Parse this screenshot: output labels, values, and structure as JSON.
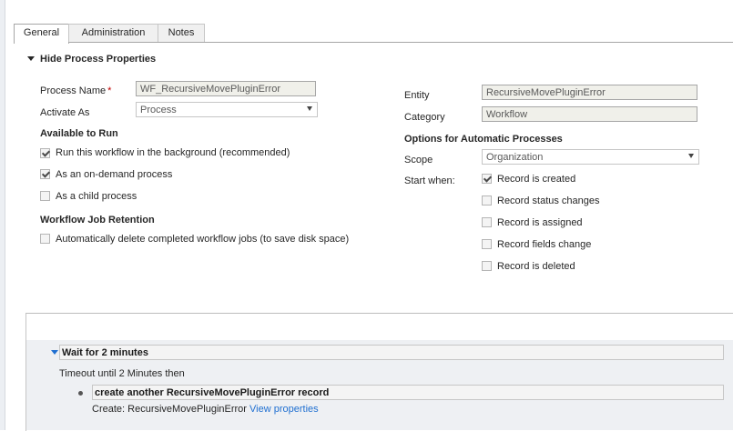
{
  "tabs": [
    {
      "label": "General",
      "active": true
    },
    {
      "label": "Administration",
      "active": false
    },
    {
      "label": "Notes",
      "active": false
    }
  ],
  "section": {
    "toggle_label": "Hide Process Properties"
  },
  "left": {
    "process_name_label": "Process Name",
    "required_mark": "*",
    "process_name_value": "WF_RecursiveMovePluginError",
    "activate_as_label": "Activate As",
    "activate_as_value": "Process",
    "available_heading": "Available to Run",
    "available_options": [
      {
        "label": "Run this workflow in the background (recommended)",
        "checked": true
      },
      {
        "label": "As an on-demand process",
        "checked": true
      },
      {
        "label": "As a child process",
        "checked": false
      }
    ],
    "retention_heading": "Workflow Job Retention",
    "retention_option": {
      "label": "Automatically delete completed workflow jobs (to save disk space)",
      "checked": false
    }
  },
  "right": {
    "entity_label": "Entity",
    "entity_value": "RecursiveMovePluginError",
    "category_label": "Category",
    "category_value": "Workflow",
    "options_heading": "Options for Automatic Processes",
    "scope_label": "Scope",
    "scope_value": "Organization",
    "start_when_label": "Start when:",
    "start_options": [
      {
        "label": "Record is created",
        "checked": true
      },
      {
        "label": "Record status changes",
        "checked": false
      },
      {
        "label": "Record is assigned",
        "checked": false
      },
      {
        "label": "Record fields change",
        "checked": false
      },
      {
        "label": "Record is deleted",
        "checked": false
      }
    ]
  },
  "designer": {
    "wait_step_title": "Wait for 2 minutes",
    "timeout_text": "Timeout until 2 Minutes then",
    "create_step_title": "create another RecursiveMovePluginError record",
    "create_detail_prefix": "Create:",
    "create_detail_entity": "RecursiveMovePluginError",
    "view_properties_link": "View properties"
  },
  "colors": {
    "link": "#1f6fd1",
    "required": "#c00000",
    "readonly_bg": "#f0f0ea"
  },
  "icons": {
    "section_toggle": "triangle-down-icon",
    "dropdown": "chevron-down-icon",
    "step_toggle": "triangle-down-icon",
    "bullet": "dot-icon"
  }
}
